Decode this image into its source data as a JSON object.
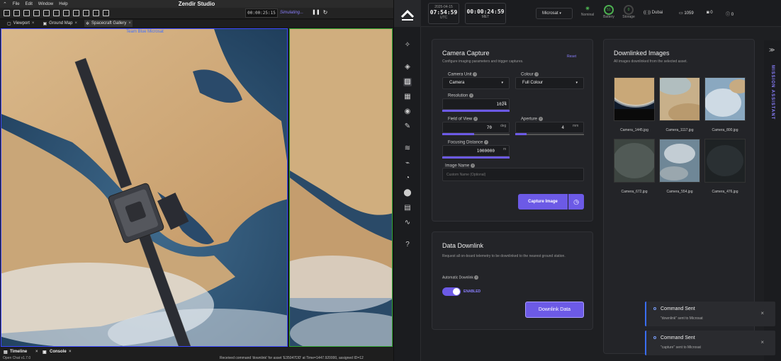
{
  "studio": {
    "title": "Zendir Studio",
    "menu": [
      "File",
      "Edit",
      "Window",
      "Help"
    ],
    "sim_time": "00:00:25:15",
    "sim_status": "Simulating...",
    "tabs": [
      {
        "label": "Viewport"
      },
      {
        "label": "Ground Map"
      },
      {
        "label": "Spacecraft Gallery"
      }
    ],
    "viewport_label": "Team Blue Microsat",
    "bottom_tabs": [
      "Timeline",
      "Console"
    ],
    "status_left": "Open Chat    v1.7.0",
    "status_right": "Received command 'downlink' for asset 'E35047DD' at Time=1447.920000, assigned ID=12"
  },
  "app": {
    "date": "2025-04-15",
    "utc_time": "07:54:59",
    "utc_label": "UTC",
    "met_time": "00:00:24:59",
    "met_label": "MET",
    "asset_select": "Microsat",
    "status": [
      {
        "label": "Nominal",
        "value": ""
      },
      {
        "label": "Battery",
        "value": "51"
      },
      {
        "label": "Storage",
        "value": "0"
      }
    ],
    "location": "Dubai",
    "counters": {
      "messages": "1059",
      "photos": "0",
      "alerts": "0"
    },
    "camera": {
      "title": "Camera Capture",
      "subtitle": "Configure imaging parameters and trigger captures.",
      "reset": "Reset",
      "unit_label": "Camera Unit",
      "unit_value": "Camera",
      "colour_label": "Colour",
      "colour_value": "Full Colour",
      "resolution_label": "Resolution",
      "resolution_value": "1024",
      "resolution_unit": "px",
      "fov_label": "Field of View",
      "fov_value": "70",
      "fov_unit": "deg",
      "aperture_label": "Aperture",
      "aperture_value": "4",
      "aperture_unit": "mm",
      "focus_label": "Focusing Distance",
      "focus_value": "1000000",
      "focus_unit": "m",
      "image_name_label": "Image Name",
      "image_name_placeholder": "Custom Name (Optional)",
      "capture_button": "Capture Image"
    },
    "downlink": {
      "title": "Data Downlink",
      "subtitle": "Request all on-board telemetry to be downlinked to the nearest ground station.",
      "auto_label": "Automatic Downlink",
      "toggle_state": "ENABLED",
      "button": "Downlink Data"
    },
    "images": {
      "title": "Downlinked Images",
      "subtitle": "All images downlinked from the selected asset.",
      "items": [
        "Camera_1445.jpg",
        "Camera_1117.jpg",
        "Camera_800.jpg",
        "Camera_672.jpg",
        "Camera_554.jpg",
        "Camera_476.jpg"
      ]
    },
    "assistant_label": "MISSION ASSISTANT",
    "toasts": [
      {
        "title": "Command Sent",
        "msg": "\"downlink\" sent to Microsat"
      },
      {
        "title": "Command Sent",
        "msg": "\"capture\" sent to Microsat"
      }
    ]
  }
}
